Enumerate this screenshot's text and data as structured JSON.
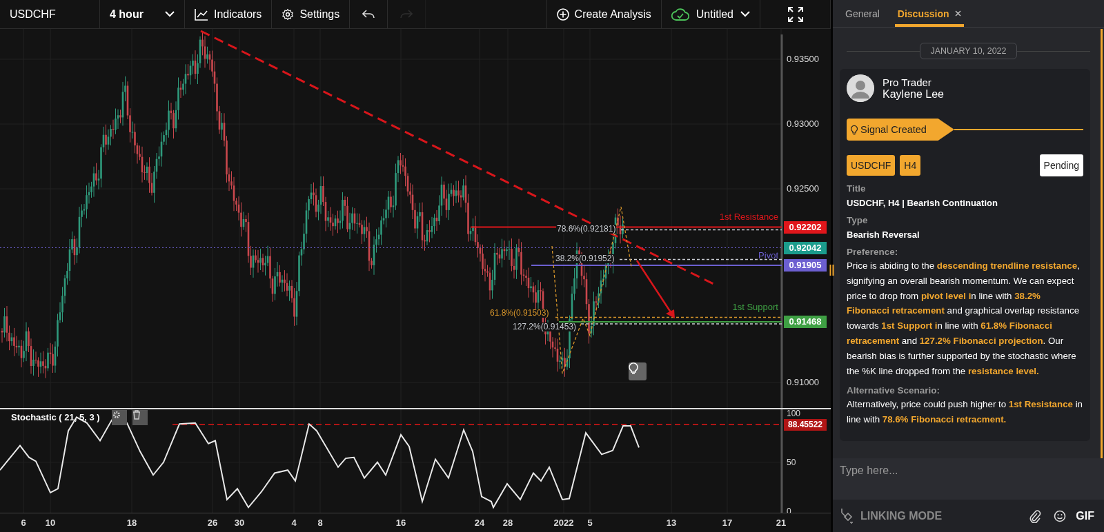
{
  "toolbar": {
    "symbol": "USDCHF",
    "interval": "4 hour",
    "tools": [
      {
        "kind": "indicators",
        "label": "Indicators"
      },
      {
        "kind": "settings",
        "label": "Settings"
      }
    ],
    "history": [
      {
        "kind": "undo",
        "disabled": false
      },
      {
        "kind": "redo",
        "disabled": true
      }
    ],
    "create_button": "Create Analysis",
    "layout_name": "Untitled"
  },
  "chart": {
    "price_ticks": [
      "0.93500",
      "0.93000",
      "0.92500",
      "0.91000"
    ],
    "levels": [
      {
        "label": "1st Resistance",
        "badge": "0.92202",
        "color": "#e0161b",
        "fibs": [
          {
            "text": "78.6%(0.92181)",
            "color": "#c9ccd2"
          }
        ]
      },
      {
        "label": "Pivot",
        "badge": "0.91905",
        "color": "#6c5fd0",
        "fibs": [
          {
            "text": "38.2%(0.91952)",
            "color": "#c9ccd2"
          }
        ]
      },
      {
        "label": "1st Support",
        "badge": "0.91468",
        "color": "#3fa044",
        "fibs": [
          {
            "text": "61.8%(0.91503)",
            "color": "#d8962a"
          },
          {
            "text": "127.2%(0.91453)",
            "color": "#c9ccd2"
          }
        ]
      }
    ],
    "last_price": {
      "badge": "0.92042",
      "color": "#1b9c8c"
    }
  },
  "stochastic": {
    "title": "Stochastic ( 21, 5, 3 )",
    "ticks": [
      "100",
      "50",
      "0"
    ],
    "reading": "88.45522"
  },
  "time_axis": [
    "6",
    "10",
    "18",
    "26",
    "30",
    "4",
    "8",
    "16",
    "24",
    "28",
    "2022",
    "5",
    "13",
    "17",
    "21"
  ],
  "sidebar": {
    "tabs": [
      {
        "label": "General",
        "selected": false,
        "closable": false
      },
      {
        "label": "Discussion",
        "selected": true,
        "closable": true
      }
    ],
    "date": "JANUARY 10, 2022",
    "post": {
      "role": "Pro Trader",
      "name": "Kaylene Lee",
      "signal": "Signal Created",
      "tags": [
        "USDCHF",
        "H4"
      ],
      "status": "Pending",
      "fields": [
        {
          "kind": "short",
          "label": "Title",
          "value": "USDCHF, H4 | Bearish Continuation"
        },
        {
          "kind": "short",
          "label": "Type",
          "value": "Bearish Reversal"
        },
        {
          "kind": "rich",
          "label": "Preference:",
          "value": "Price is abiding to the **descending trendline resistance**, signifying an overall bearish momentum. We can expect price to drop from **pivot level i**n line with **38.2% Fibonacci retracement** and graphical overlap resistance towards **1st Support i**n line with **61.8% Fibonacci retracement** and **127.2% Fibonacci projection**. Our bearish bias is further supported by the stochastic where the %K line dropped from the **resistance level.**"
        },
        {
          "kind": "rich",
          "label": "Alternative Scenario:",
          "value": "Alternatively, price could push higher to **1st Resistance** in line with **78.6% Fibonacci retracment.**"
        }
      ]
    },
    "composer": {
      "placeholder": "Type here..."
    },
    "footer": {
      "mode": "LINKING MODE",
      "gif": "GIF"
    }
  }
}
